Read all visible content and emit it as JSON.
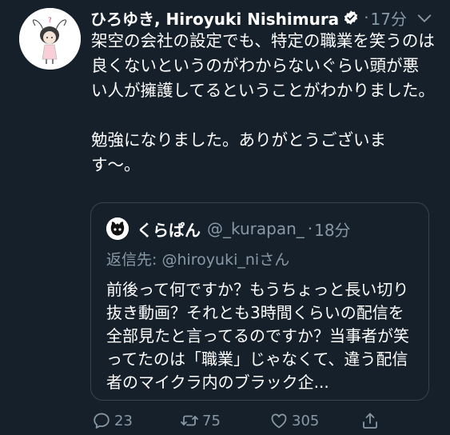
{
  "tweet": {
    "display_name": "ひろゆき, Hiroyuki Nishimura",
    "dot": "·",
    "time": "17分",
    "body": "架空の会社の設定でも、特定の職業を笑うのは良くないというのがわからないぐらい頭が悪い人が擁護してるということがわかりました。\n\n勉強になりました。ありがとうございます〜。"
  },
  "quote": {
    "display_name": "くらぱん",
    "handle": "@_kurapan_",
    "dot": "·",
    "time": "18分",
    "reply_label": "返信先: ",
    "reply_to": "@hiroyuki_ni",
    "reply_suffix": "さん",
    "body": "前後って何ですか？もうちょっと長い切り抜き動画？それとも3時間くらいの配信を全部見たと言ってるのですか？当事者が笑ってたのは「職業」じゃなくて、違う配信者のマイクラ内のブラック企..."
  },
  "actions": {
    "reply_count": "23",
    "retweet_count": "75",
    "like_count": "305"
  },
  "colors": {
    "background": "#15202b",
    "secondary_text": "#8899a6",
    "border": "#38444d",
    "verified": "#ffffff"
  }
}
